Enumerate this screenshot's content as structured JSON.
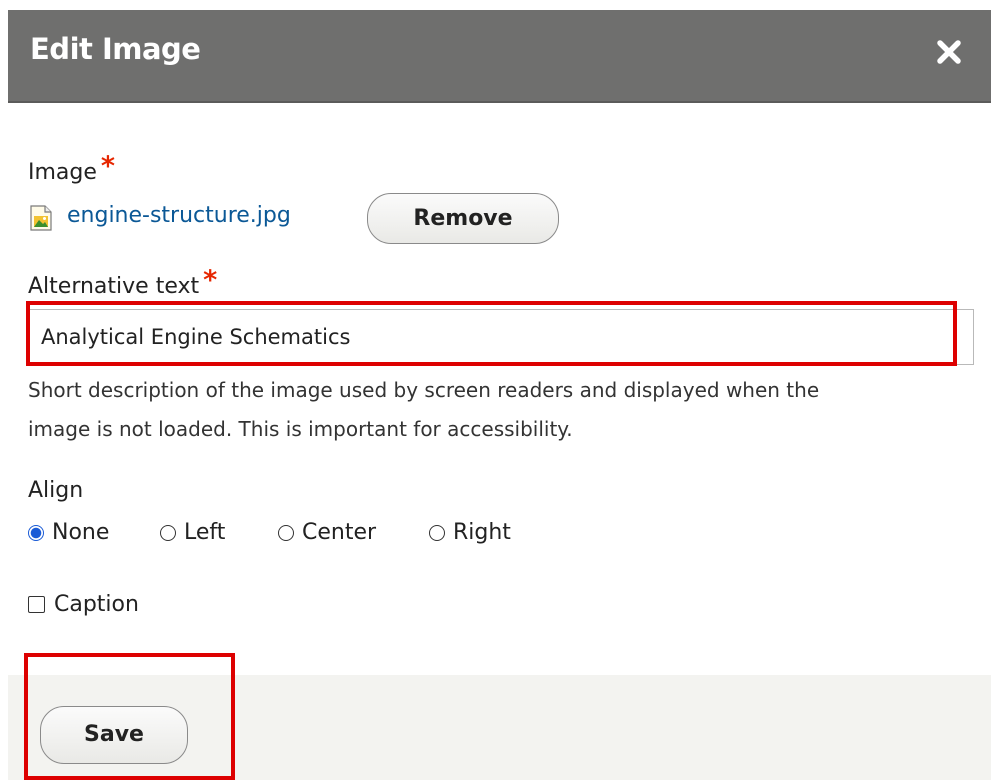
{
  "dialog": {
    "title": "Edit Image",
    "close_icon": "close-icon"
  },
  "image_field": {
    "label": "Image",
    "required_marker": "*",
    "file_icon": "image-file-icon",
    "file_name": "engine-structure.jpg",
    "remove_label": "Remove"
  },
  "alt_text": {
    "label": "Alternative text",
    "required_marker": "*",
    "value": "Analytical Engine Schematics",
    "description_line1": "Short description of the image used by screen readers and displayed when the",
    "description_line2": "image is not loaded. This is important for accessibility."
  },
  "align": {
    "label": "Align",
    "selected": "None",
    "options": [
      {
        "label": "None",
        "checked": true
      },
      {
        "label": "Left",
        "checked": false
      },
      {
        "label": "Center",
        "checked": false
      },
      {
        "label": "Right",
        "checked": false
      }
    ]
  },
  "caption": {
    "label": "Caption",
    "checked": false
  },
  "footer": {
    "save_label": "Save"
  },
  "colors": {
    "titlebar": "#6f6f6e",
    "link": "#0b5896",
    "required": "#e62600",
    "highlight": "#dd0000",
    "radio_selected": "#1a5bd6",
    "footer_bg": "#f3f3f0"
  }
}
